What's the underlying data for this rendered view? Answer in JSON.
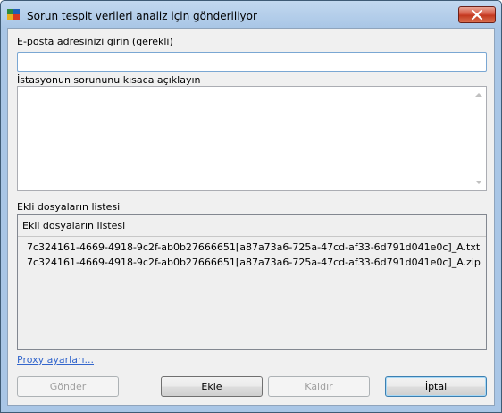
{
  "window": {
    "title": "Sorun tespit verileri analiz için gönderiliyor"
  },
  "email": {
    "label": "E-posta adresinizi girin (gerekli)",
    "value": "",
    "placeholder": ""
  },
  "description": {
    "label": "İstasyonun sorununu kısaca açıklayın",
    "value": ""
  },
  "attachments": {
    "label": "Ekli dosyaların listesi",
    "column_header": "Ekli dosyaların listesi",
    "files": [
      "7c324161-4669-4918-9c2f-ab0b27666651[a87a73a6-725a-47cd-af33-6d791d041e0c]_A.txt",
      "7c324161-4669-4918-9c2f-ab0b27666651[a87a73a6-725a-47cd-af33-6d791d041e0c]_A.zip"
    ]
  },
  "proxy_link": "Proxy ayarları...",
  "buttons": {
    "send": "Gönder",
    "add": "Ekle",
    "remove": "Kaldır",
    "cancel": "İptal"
  },
  "icons": {
    "app": "avg-logo-icon",
    "close": "close-icon"
  }
}
